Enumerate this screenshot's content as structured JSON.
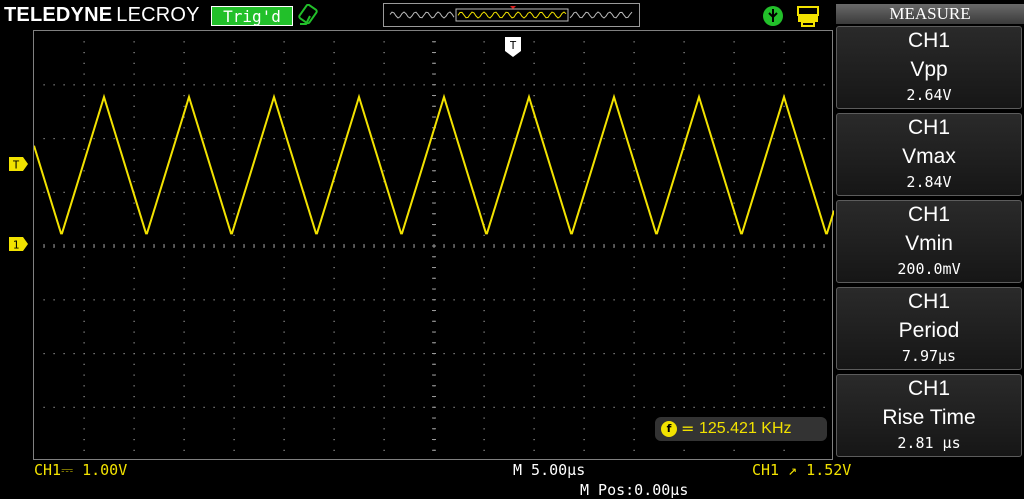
{
  "header": {
    "brand_bold": "TELEDYNE",
    "brand_light": "LECROY",
    "trigger_status": "Trig'd",
    "icons": [
      "trigger-icon",
      "usb-icon",
      "printer-icon"
    ]
  },
  "screen": {
    "trace_color": "#f2e200",
    "trigger_position_marker": "T",
    "trigger_level_marker": "T",
    "channel_marker": "1"
  },
  "frequency_readout": {
    "icon": "f",
    "equals": "=",
    "value": "125.421 KHz"
  },
  "bottom": {
    "ch1_scale": "CH1⎓ 1.00V",
    "time_base": "M 5.00μs",
    "trigger_level": "CH1 ↗ 1.52V",
    "m_pos": "M Pos:0.00μs"
  },
  "measure": {
    "header": "MEASURE",
    "items": [
      {
        "channel": "CH1",
        "name": "Vpp",
        "value": "2.64V"
      },
      {
        "channel": "CH1",
        "name": "Vmax",
        "value": "2.84V"
      },
      {
        "channel": "CH1",
        "name": "Vmin",
        "value": "200.0mV"
      },
      {
        "channel": "CH1",
        "name": "Period",
        "value": "7.97μs"
      },
      {
        "channel": "CH1",
        "name": "Rise Time",
        "value": "2.81 μs"
      }
    ]
  }
}
